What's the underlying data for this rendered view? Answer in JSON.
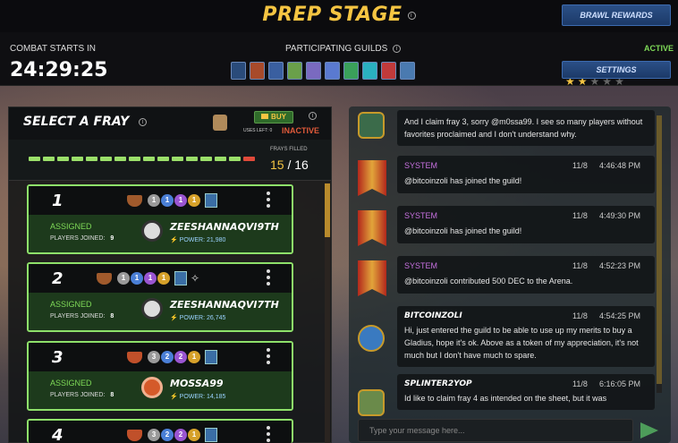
{
  "header": {
    "title": "PREP STAGE",
    "brawl_rewards_label": "BRAWL REWARDS",
    "settings_label": "SETTINGS"
  },
  "combat": {
    "label": "COMBAT STARTS IN",
    "timer": "24:29:25"
  },
  "guilds": {
    "label": "PARTICIPATING GUILDS",
    "icon_count": 10
  },
  "status": {
    "stars_filled": 2,
    "stars_total": 5,
    "active_label": "ACTIVE",
    "active_color": "#7ed957"
  },
  "fray_panel": {
    "title": "SELECT A FRAY",
    "buy_label": "BUY",
    "uses_left_label": "USES LEFT:",
    "uses_left_value": "0",
    "inactive_label": "INACTIVE",
    "frays_filled_label": "FRAYS FILLED",
    "frays_filled_current": "15",
    "frays_filled_sep": "/",
    "frays_filled_total": "16"
  },
  "frays": [
    {
      "number": "1",
      "status": "ASSIGNED",
      "players_label": "PLAYERS JOINED:",
      "players": "9",
      "rules": [
        "1",
        "1",
        "1",
        "1"
      ],
      "player": "ZEESHANNAQVI9TH",
      "power_label": "POWER:",
      "power": "21,980"
    },
    {
      "number": "2",
      "status": "ASSIGNED",
      "players_label": "PLAYERS JOINED:",
      "players": "8",
      "rules": [
        "1",
        "1",
        "1",
        "1"
      ],
      "player": "ZEESHANNAQVI7TH",
      "power_label": "POWER:",
      "power": "26,745"
    },
    {
      "number": "3",
      "status": "ASSIGNED",
      "players_label": "PLAYERS JOINED:",
      "players": "8",
      "rules": [
        "3",
        "2",
        "2",
        "1"
      ],
      "player": "MOSSA99",
      "power_label": "POWER:",
      "power": "14,185"
    },
    {
      "number": "4",
      "rules": [
        "3",
        "2",
        "2",
        "1"
      ]
    }
  ],
  "chat": {
    "messages": [
      {
        "text": "And I claim fray 3, sorry @m0ssa99. I see so many players without favorites proclaimed and I don't understand why."
      },
      {
        "name": "SYSTEM",
        "date": "11/8",
        "time": "4:46:48 PM",
        "text": "@bitcoinzoli has joined the guild!"
      },
      {
        "name": "SYSTEM",
        "date": "11/8",
        "time": "4:49:30 PM",
        "text": "@bitcoinzoli has joined the guild!"
      },
      {
        "name": "SYSTEM",
        "date": "11/8",
        "time": "4:52:23 PM",
        "text": "@bitcoinzoli contributed 500 DEC to the Arena."
      },
      {
        "name": "BITCOINZOLI",
        "date": "11/8",
        "time": "4:54:25 PM",
        "text": "Hi, just entered the guild to be able to use up my merits to buy a Gladius, hope it's ok. Above as a token of my appreciation, it's not much but I don't have much to spare."
      },
      {
        "name": "SPLINTER2YOP",
        "date": "11/8",
        "time": "6:16:05 PM",
        "text": "Id like to claim fray 4 as intended on the sheet, but it was"
      }
    ],
    "input_placeholder": "Type your message here..."
  }
}
